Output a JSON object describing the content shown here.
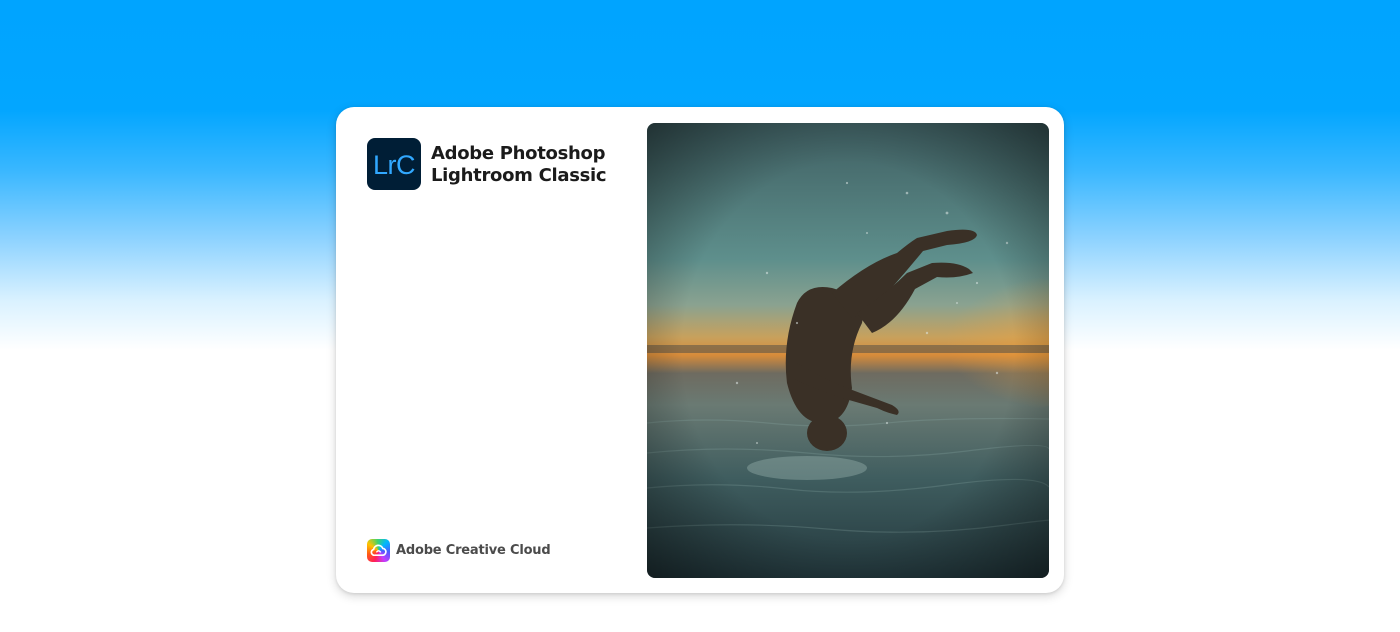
{
  "app": {
    "logo_text": "LrC",
    "title_line1": "Adobe Photoshop",
    "title_line2": "Lightroom Classic",
    "logo_bg": "#001e36",
    "logo_fg": "#31a8ff"
  },
  "brand": {
    "name": "Adobe Creative Cloud",
    "icon": "creative-cloud-icon"
  },
  "photo": {
    "subject": "splash-artwork-backflip"
  },
  "colors": {
    "sky_top": "#00a4ff",
    "background": "#ffffff"
  }
}
